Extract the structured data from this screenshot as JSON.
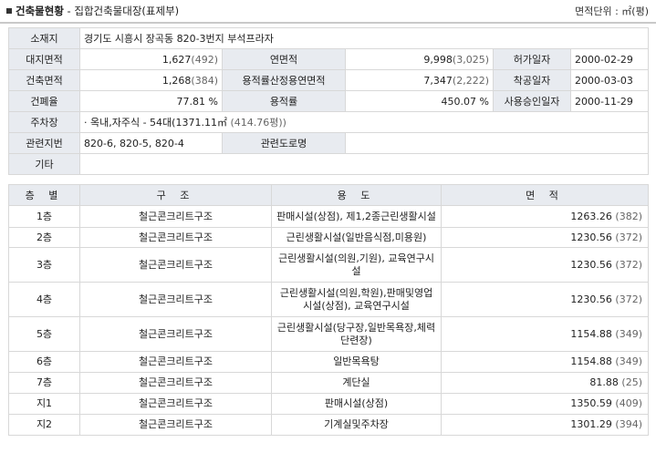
{
  "header": {
    "title_bold": "건축물현황",
    "title_rest": " - 집합건축물대장(표제부)",
    "unit": "면적단위 : ㎡(평)"
  },
  "info": {
    "address_label": "소재지",
    "address": "경기도 시흥시 장곡동 820-3번지 부석프라자",
    "land_area_label": "대지면적",
    "land_area": "1,627",
    "land_area_py": "(492)",
    "total_area_label": "연면적",
    "total_area": "9,998",
    "total_area_py": "(3,025)",
    "permit_label": "허가일자",
    "permit_date": "2000-02-29",
    "building_area_label": "건축면적",
    "building_area": "1,268",
    "building_area_py": "(384)",
    "far_area_label": "용적률산정용연면적",
    "far_area": "7,347",
    "far_area_py": "(2,222)",
    "start_label": "착공일자",
    "start_date": "2000-03-03",
    "bcr_label": "건폐율",
    "bcr": "77.81 %",
    "far_label": "용적률",
    "far": "450.07 %",
    "approval_label": "사용승인일자",
    "approval_date": "2000-11-29",
    "parking_label": "주차장",
    "parking": "· 옥내,자주식 - 54대(1371.11㎡",
    "parking_py": " (414.76평))",
    "related_lot_label": "관련지번",
    "related_lot": "820-6, 820-5, 820-4",
    "related_road_label": "관련도로명",
    "related_road": "",
    "etc_label": "기타",
    "etc": ""
  },
  "floors_table": {
    "headers": [
      "층 별",
      "구 조",
      "용 도",
      "면 적"
    ],
    "rows": [
      {
        "floor": "1층",
        "structure": "철근콘크리트구조",
        "use": "판매시설(상점), 제1,2종근린생활시설",
        "area": "1263.26",
        "area_py": "(382)"
      },
      {
        "floor": "2층",
        "structure": "철근콘크리트구조",
        "use": "근린생활시설(일반음식점,미용원)",
        "area": "1230.56",
        "area_py": "(372)"
      },
      {
        "floor": "3층",
        "structure": "철근콘크리트구조",
        "use": "근린생활시설(의원,기원), 교육연구시설",
        "area": "1230.56",
        "area_py": "(372)"
      },
      {
        "floor": "4층",
        "structure": "철근콘크리트구조",
        "use": "근린생활시설(의원,학원),판매및영업시설(상점), 교육연구시설",
        "area": "1230.56",
        "area_py": "(372)"
      },
      {
        "floor": "5층",
        "structure": "철근콘크리트구조",
        "use": "근린생활시설(당구장,일반목욕장,체력단련장)",
        "area": "1154.88",
        "area_py": "(349)"
      },
      {
        "floor": "6층",
        "structure": "철근콘크리트구조",
        "use": "일반목욕탕",
        "area": "1154.88",
        "area_py": "(349)"
      },
      {
        "floor": "7층",
        "structure": "철근콘크리트구조",
        "use": "계단실",
        "area": "81.88",
        "area_py": "(25)"
      },
      {
        "floor": "지1",
        "structure": "철근콘크리트구조",
        "use": "판매시설(상점)",
        "area": "1350.59",
        "area_py": "(409)"
      },
      {
        "floor": "지2",
        "structure": "철근콘크리트구조",
        "use": "기계실및주차장",
        "area": "1301.29",
        "area_py": "(394)"
      }
    ]
  }
}
